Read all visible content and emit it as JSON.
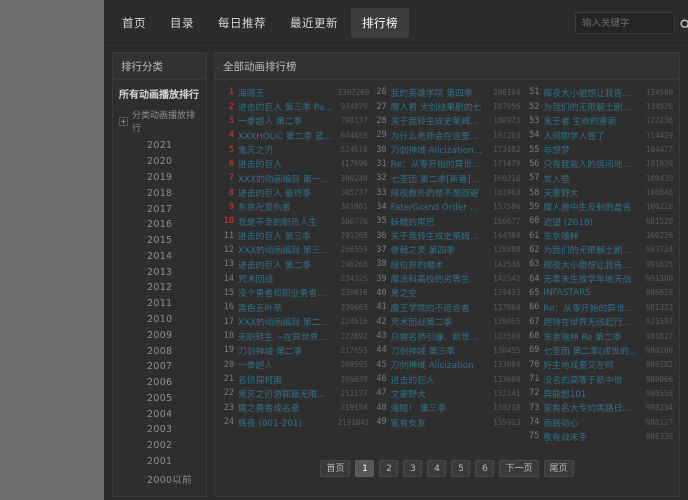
{
  "nav": {
    "items": [
      {
        "label": "首页",
        "active": false
      },
      {
        "label": "目录",
        "active": false
      },
      {
        "label": "每日推荐",
        "active": false
      },
      {
        "label": "最近更新",
        "active": false
      },
      {
        "label": "排行榜",
        "active": true
      }
    ]
  },
  "search": {
    "placeholder": "输入关键字",
    "value": "",
    "icon": "search-icon"
  },
  "sidebar": {
    "title": "排行分类",
    "root_label": "所有动画播放排行",
    "group_label": "分类动画播放排行",
    "expander": "+",
    "years": [
      "2021",
      "2020",
      "2019",
      "2018",
      "2017",
      "2016",
      "2015",
      "2014",
      "2013",
      "2012",
      "2011",
      "2010",
      "2009",
      "2008",
      "2007",
      "2006",
      "2005",
      "2004",
      "2003",
      "2002",
      "2001",
      "2000以前"
    ]
  },
  "main": {
    "title": "全部动画排行榜",
    "columns": [
      {
        "rows": [
          {
            "rank": "1",
            "title": "海贼王",
            "hits": "1397260"
          },
          {
            "rank": "2",
            "title": "进击的巨人 第三季 Pa...",
            "hits": "934879"
          },
          {
            "rank": "3",
            "title": "一拳超人 第二季",
            "hits": "798137"
          },
          {
            "rank": "4",
            "title": "XXXHOLiC 第二季 蓝...",
            "hits": "644655"
          },
          {
            "rank": "5",
            "title": "鬼灭之刃",
            "hits": "524678"
          },
          {
            "rank": "6",
            "title": "进击的巨人",
            "hits": "417696"
          },
          {
            "rank": "7",
            "title": "XXX的动画编目 第一...",
            "hits": "390249"
          },
          {
            "rank": "8",
            "title": "进击的巨人 最终季",
            "hits": "305737"
          },
          {
            "rank": "9",
            "title": "东京卍复仇者",
            "hits": "301981"
          },
          {
            "rank": "10",
            "title": "我是不幸的职员人生",
            "hits": "300776"
          },
          {
            "rank": "11",
            "title": "进击的巨人 第三季",
            "hits": "291268"
          },
          {
            "rank": "12",
            "title": "XXX的动画编目 第三...",
            "hits": "266559"
          },
          {
            "rank": "13",
            "title": "进击的巨人 第二季",
            "hits": "246266"
          },
          {
            "rank": "14",
            "title": "咒术回战",
            "hits": "234325"
          },
          {
            "rank": "15",
            "title": "没个勇者和职业勇者的...",
            "hits": "230616"
          },
          {
            "rank": "16",
            "title": "黑色五叶草",
            "hits": "230663"
          },
          {
            "rank": "17",
            "title": "XXX的动画编目 第二...",
            "hits": "224616"
          },
          {
            "rank": "18",
            "title": "无职转生 ~在异世界...",
            "hits": "222892"
          },
          {
            "rank": "19",
            "title": "刀剑神域 第二季",
            "hits": "217655"
          },
          {
            "rank": "20",
            "title": "一拳超人",
            "hits": "209595"
          },
          {
            "rank": "21",
            "title": "名侦探柯南",
            "hits": "206639"
          },
          {
            "rank": "22",
            "title": "鬼灭之刃游郭篇无限...",
            "hits": "212177"
          },
          {
            "rank": "23",
            "title": "属之勇者成名录",
            "hits": "219154"
          },
          {
            "rank": "24",
            "title": "辉夜 (001-201)",
            "hits": "2191841"
          }
        ]
      },
      {
        "rows": [
          {
            "rank": "26",
            "title": "我的英雄学院 第四季",
            "hits": "200104"
          },
          {
            "rank": "27",
            "title": "魔人君 大剑结果剧的七",
            "hits": "187056"
          },
          {
            "rank": "28",
            "title": "关于我转生成史莱姆...",
            "hits": "180973"
          },
          {
            "rank": "29",
            "title": "为什么老师会在这里！？",
            "hits": "162203"
          },
          {
            "rank": "30",
            "title": "刀剑神域 Alicization...",
            "hits": "173102"
          },
          {
            "rank": "31",
            "title": "Re：从零开始的异世...",
            "hits": "171479"
          },
          {
            "rank": "32",
            "title": "七圣团 第二季[新番]...",
            "hits": "160218"
          },
          {
            "rank": "33",
            "title": "辉夜教外的是不是回避",
            "hits": "161963"
          },
          {
            "rank": "34",
            "title": "Fate/Grand Order 绝...",
            "hits": "157586"
          },
          {
            "rank": "35",
            "title": "妖精的尾巴",
            "hits": "156677"
          },
          {
            "rank": "36",
            "title": "关于我转生成史莱姆...",
            "hits": "144384"
          },
          {
            "rank": "37",
            "title": "食戟之灵 第四季",
            "hits": "138888"
          },
          {
            "rank": "38",
            "title": "段位界的魔术",
            "hits": "142536"
          },
          {
            "rank": "39",
            "title": "魔法科高校的劣等生",
            "hits": "142542"
          },
          {
            "rank": "40",
            "title": "鬼之空",
            "hits": "139433"
          },
          {
            "rank": "41",
            "title": "魔王学院的不适合者",
            "hits": "137864"
          },
          {
            "rank": "42",
            "title": "咒术回战第二季",
            "hits": "139055"
          },
          {
            "rank": "43",
            "title": "只需名师引爆、新世纪...",
            "hits": "133569"
          },
          {
            "rank": "44",
            "title": "刀剑神域 第三季",
            "hits": "130455"
          },
          {
            "rank": "45",
            "title": "刀剑神域 Alicization",
            "hits": "133684"
          },
          {
            "rank": "46",
            "title": "进击的巨人",
            "hits": "133600"
          },
          {
            "rank": "47",
            "title": "文豪野犬",
            "hits": "132141"
          },
          {
            "rank": "48",
            "title": "海贼！ 第三季",
            "hits": "130218"
          },
          {
            "rank": "49",
            "title": "家有女友",
            "hits": "135923"
          }
        ]
      },
      {
        "rows": [
          {
            "rank": "51",
            "title": "辉夜大小姐想让我告白...",
            "hits": "134580"
          },
          {
            "rank": "52",
            "title": "为我们的无限解土剧画！",
            "hits": "134526"
          },
          {
            "rank": "53",
            "title": "鬼王者 生命的重新",
            "hits": "122236"
          },
          {
            "rank": "54",
            "title": "人间即学人冒了",
            "hits": "114429"
          },
          {
            "rank": "55",
            "title": "非想梦",
            "hits": "104477"
          },
          {
            "rank": "56",
            "title": "只有我能入的房间地下城",
            "hits": "101039"
          },
          {
            "rank": "57",
            "title": "炭入壁",
            "hits": "100430"
          },
          {
            "rank": "58",
            "title": "天董野大",
            "hits": "100646"
          },
          {
            "rank": "59",
            "title": "魔人兽中生反射的盖名",
            "hits": "100226"
          },
          {
            "rank": "60",
            "title": "迟望 (2018)",
            "hits": "981520"
          },
          {
            "rank": "61",
            "title": "东京喰种",
            "hits": "100226"
          },
          {
            "rank": "62",
            "title": "为我们的无限解土剧画...",
            "hits": "983724"
          },
          {
            "rank": "63",
            "title": "辉夜大小姐想让我告白...",
            "hits": "991625"
          },
          {
            "rank": "64",
            "title": "无毒未生放学年地天战",
            "hits": "991300"
          },
          {
            "rank": "65",
            "title": "INFASTARS",
            "hits": "986628"
          },
          {
            "rank": "66",
            "title": "Re：从零开始的异世...",
            "hits": "981373"
          },
          {
            "rank": "67",
            "title": "超待在世界无线起行变...",
            "hits": "921597"
          },
          {
            "rank": "68",
            "title": "东京喰种 Re 第二季",
            "hits": "981827"
          },
          {
            "rank": "69",
            "title": "七圣团 第二季[成世的...",
            "hits": "980106"
          },
          {
            "rank": "70",
            "title": "好主地戏要又左时",
            "hits": "980282"
          },
          {
            "rank": "71",
            "title": "没名的高等于新中世",
            "hits": "980066"
          },
          {
            "rank": "72",
            "title": "异能超101",
            "hits": "980558"
          },
          {
            "rank": "73",
            "title": "家有名大专的黑路日行...",
            "hits": "988234"
          },
          {
            "rank": "74",
            "title": "雨路动心",
            "hits": "988127"
          },
          {
            "rank": "75",
            "title": "敬有战末手",
            "hits": "886336"
          }
        ]
      }
    ]
  },
  "pagination": {
    "items": [
      {
        "label": "首页",
        "active": false
      },
      {
        "label": "1",
        "active": true
      },
      {
        "label": "2",
        "active": false
      },
      {
        "label": "3",
        "active": false
      },
      {
        "label": "4",
        "active": false
      },
      {
        "label": "5",
        "active": false
      },
      {
        "label": "6",
        "active": false
      },
      {
        "label": "下一页",
        "active": false
      },
      {
        "label": "尾页",
        "active": false
      }
    ]
  }
}
